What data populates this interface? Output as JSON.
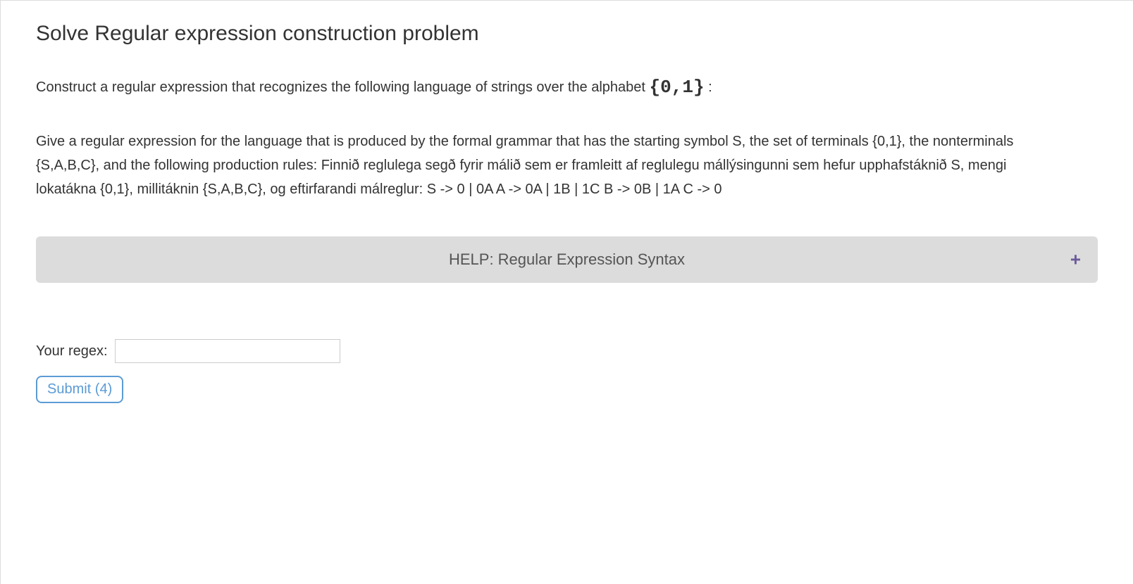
{
  "title": "Solve Regular expression construction problem",
  "intro_prefix": "Construct a regular expression that recognizes the following language of strings over the alphabet ",
  "alphabet": "{0,1}",
  "intro_suffix": "  :",
  "description": "Give a regular expression for the language that is produced by the formal grammar that has the starting symbol S, the set of terminals {0,1}, the nonterminals {S,A,B,C}, and the following production rules: Finnið reglulega segð fyrir málið sem er framleitt af reglulegu mállýsingunni sem hefur upphafstáknið S, mengi lokatákna {0,1}, millitáknin {S,A,B,C}, og eftirfarandi málreglur: S -> 0 | 0A A -> 0A | 1B | 1C B -> 0B | 1A C -> 0",
  "help": {
    "title": "HELP: Regular Expression Syntax",
    "expand_symbol": "+"
  },
  "regex": {
    "label": "Your regex:",
    "value": "",
    "placeholder": ""
  },
  "submit_label": "Submit (4)"
}
